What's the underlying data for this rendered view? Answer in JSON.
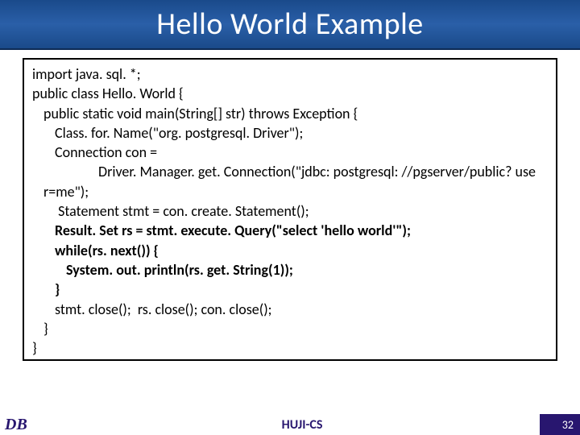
{
  "header": {
    "title": "Hello World Example"
  },
  "code": {
    "l1": "import java. sql. *;",
    "l2": "public class Hello. World {",
    "l3": "public static void main(String[] str) throws Exception {",
    "l4": "Class. for. Name(\"org. postgresql. Driver\");",
    "l5": "Connection con =",
    "l6": "Driver. Manager. get. Connection(\"jdbc: postgresql: //pgserver/public? use",
    "l7": "r=me\");",
    "l8": " Statement stmt = con. create. Statement();",
    "l9": "Result. Set rs = stmt. execute. Query(\"select 'hello world'\");",
    "l10": "while(rs. next()) {",
    "l11": "System. out. println(rs. get. String(1));",
    "l12": "}",
    "l13": "stmt. close();  rs. close(); con. close();",
    "l14": "}",
    "l15": "}"
  },
  "footer": {
    "left": "DB",
    "center": "HUJI-CS",
    "page": "32"
  }
}
